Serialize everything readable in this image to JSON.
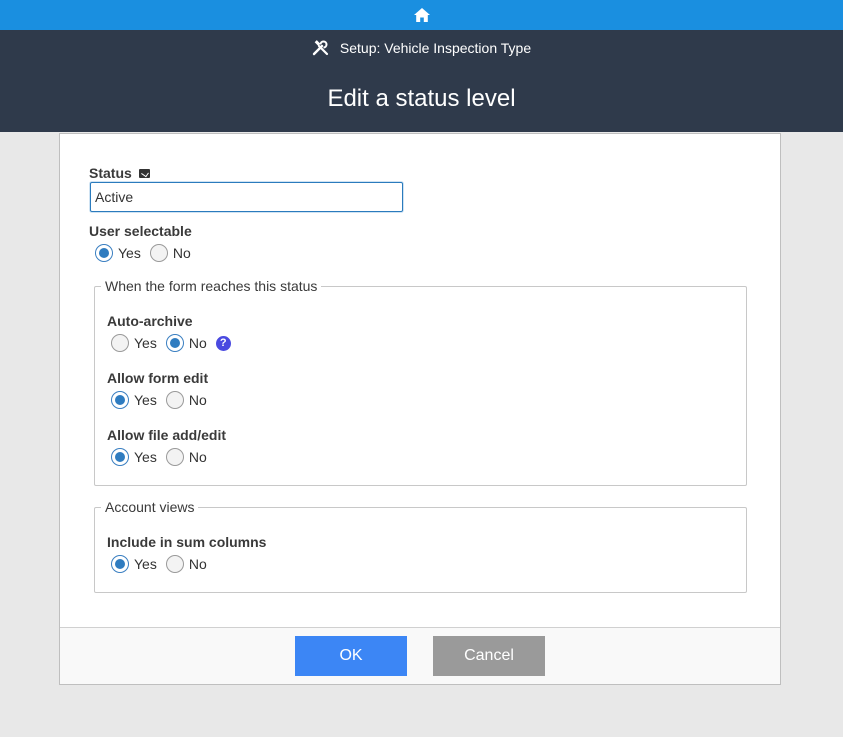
{
  "topbar": {
    "home_icon": "home-icon",
    "color": "#1a8fe0"
  },
  "header": {
    "setup_icon": "tools-icon",
    "setup_text": "Setup: Vehicle Inspection Type",
    "title": "Edit a status level",
    "background": "#2f3a4b"
  },
  "form": {
    "status": {
      "label": "Status",
      "value": "Active"
    },
    "user_selectable": {
      "label": "User selectable",
      "yes": "Yes",
      "no": "No",
      "selected": "Yes"
    },
    "status_group": {
      "legend": "When the form reaches this status",
      "auto_archive": {
        "label": "Auto-archive",
        "yes": "Yes",
        "no": "No",
        "selected": "No",
        "help": "?"
      },
      "allow_form_edit": {
        "label": "Allow form edit",
        "yes": "Yes",
        "no": "No",
        "selected": "Yes"
      },
      "allow_file_edit": {
        "label": "Allow file add/edit",
        "yes": "Yes",
        "no": "No",
        "selected": "Yes"
      }
    },
    "account_group": {
      "legend": "Account views",
      "include_sum": {
        "label": "Include in sum columns",
        "yes": "Yes",
        "no": "No",
        "selected": "Yes"
      }
    }
  },
  "footer": {
    "ok_label": "OK",
    "cancel_label": "Cancel",
    "ok_color": "#3c86f5",
    "cancel_color": "#9a9a9a"
  }
}
